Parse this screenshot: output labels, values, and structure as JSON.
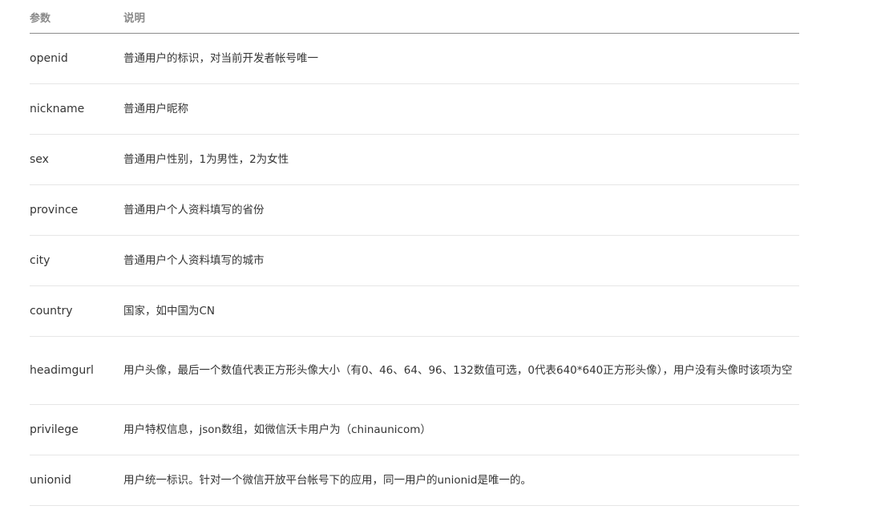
{
  "header": {
    "col_param": "参数",
    "col_desc": "说明"
  },
  "rows": [
    {
      "param": "openid",
      "desc": "普通用户的标识，对当前开发者帐号唯一"
    },
    {
      "param": "nickname",
      "desc": "普通用户昵称"
    },
    {
      "param": "sex",
      "desc": "普通用户性别，1为男性，2为女性"
    },
    {
      "param": "province",
      "desc": "普通用户个人资料填写的省份"
    },
    {
      "param": "city",
      "desc": "普通用户个人资料填写的城市"
    },
    {
      "param": "country",
      "desc": "国家，如中国为CN"
    },
    {
      "param": "headimgurl",
      "desc": "用户头像，最后一个数值代表正方形头像大小（有0、46、64、96、132数值可选，0代表640*640正方形头像），用户没有头像时该项为空"
    },
    {
      "param": "privilege",
      "desc": "用户特权信息，json数组，如微信沃卡用户为（chinaunicom）"
    },
    {
      "param": "unionid",
      "desc": "用户统一标识。针对一个微信开放平台帐号下的应用，同一用户的unionid是唯一的。"
    }
  ]
}
